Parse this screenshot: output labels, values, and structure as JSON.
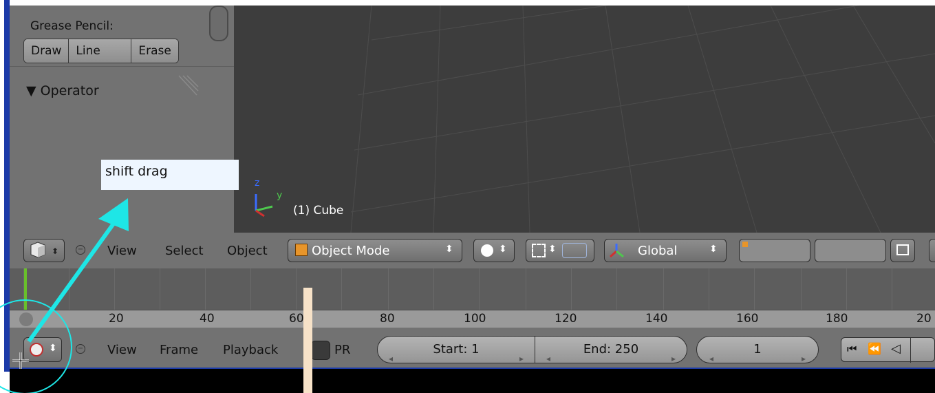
{
  "tool_panel": {
    "grease_pencil_label": "Grease Pencil:",
    "buttons": [
      "Draw",
      "Line",
      "Erase"
    ],
    "operator_title": "▼ Operator"
  },
  "annotation": {
    "note_text": "shift  drag"
  },
  "viewport": {
    "object_label": "(1) Cube",
    "axis_z": "z",
    "axis_y": "y"
  },
  "view3d_header": {
    "menus": [
      "View",
      "Select",
      "Object"
    ],
    "mode_label": "Object Mode",
    "orientation_label": "Global"
  },
  "timeline": {
    "ticks": [
      "20",
      "40",
      "60",
      "80",
      "100",
      "120",
      "140",
      "160",
      "180",
      "20"
    ],
    "menus": [
      "View",
      "Frame",
      "Playback"
    ],
    "pr_label": "PR",
    "start_label": "Start: 1",
    "end_label": "End: 250",
    "current_frame": "1"
  },
  "colors": {
    "annotation_cyan": "#1ee6e6",
    "frame_marker": "#69c02a",
    "cursor_line": "#f7e2c8"
  }
}
